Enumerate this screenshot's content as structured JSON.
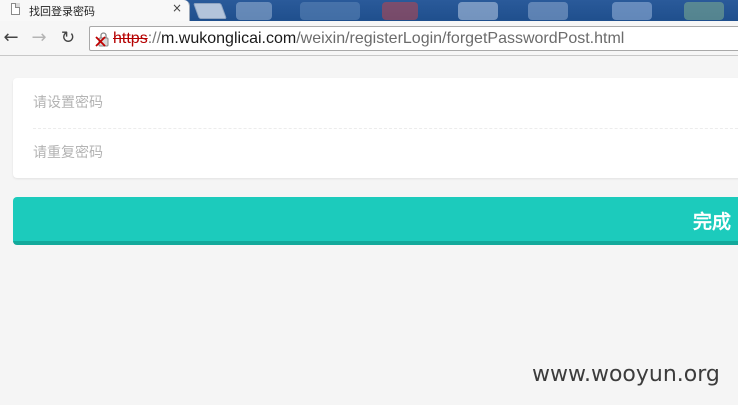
{
  "browser": {
    "tab": {
      "title": "找回登录密码",
      "close_glyph": "×"
    },
    "nav": {
      "back_glyph": "←",
      "forward_glyph": "→",
      "reload_glyph": "↻"
    },
    "address": {
      "scheme": "https",
      "separator": "://",
      "host": "m.wukonglicai.com",
      "path": "/weixin/registerLogin/forgetPasswordPost.html",
      "security_icon": "broken-lock-icon",
      "security_color": "#b50000"
    }
  },
  "form": {
    "new_password_placeholder": "请设置密码",
    "repeat_password_placeholder": "请重复密码",
    "submit_label": "完成",
    "accent_color": "#1ccbbc"
  },
  "watermark": "www.wooyun.org"
}
